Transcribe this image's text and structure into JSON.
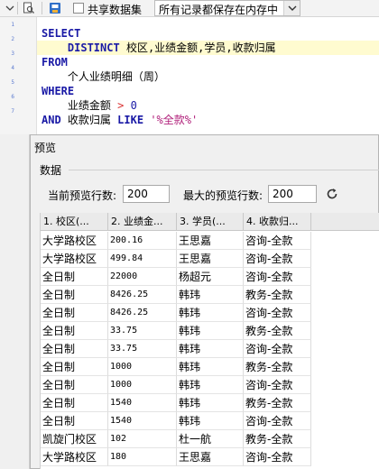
{
  "toolbar": {
    "share_label": "共享数据集",
    "storage_select": "所有记录都保存在内存中"
  },
  "editor": {
    "lines": [
      {
        "n": "1"
      },
      {
        "n": "2"
      },
      {
        "n": "3"
      },
      {
        "n": "4"
      },
      {
        "n": "5"
      },
      {
        "n": "6"
      },
      {
        "n": "7"
      }
    ],
    "select_kw": "SELECT",
    "distinct_kw": "DISTINCT",
    "columns": "校区,业绩金额,学员,收款归属",
    "from_kw": "FROM",
    "table": "个人业绩明细（周）",
    "where_kw": "WHERE",
    "cond1_field": "业绩金额",
    "cond1_op": ">",
    "cond1_val": "0",
    "and_kw": "AND",
    "cond2_field": "收款归属",
    "like_kw": "LIKE",
    "cond2_val": "'%全款%'"
  },
  "dialog": {
    "title": "预览",
    "group": "数据",
    "current_rows_label": "当前预览行数:",
    "current_rows_value": "200",
    "max_rows_label": "最大的预览行数:",
    "max_rows_value": "200"
  },
  "grid": {
    "headers": [
      "1. 校区(...",
      "2. 业绩金...",
      "3. 学员(...",
      "4. 收款归..."
    ],
    "rows": [
      [
        "大学路校区",
        "200.16",
        "王思嘉",
        "咨询-全款"
      ],
      [
        "大学路校区",
        "499.84",
        "王思嘉",
        "咨询-全款"
      ],
      [
        "全日制",
        "22000",
        "杨超元",
        "咨询-全款"
      ],
      [
        "全日制",
        "8426.25",
        "韩玮",
        "教务-全款"
      ],
      [
        "全日制",
        "8426.25",
        "韩玮",
        "咨询-全款"
      ],
      [
        "全日制",
        "33.75",
        "韩玮",
        "教务-全款"
      ],
      [
        "全日制",
        "33.75",
        "韩玮",
        "咨询-全款"
      ],
      [
        "全日制",
        "1000",
        "韩玮",
        "教务-全款"
      ],
      [
        "全日制",
        "1000",
        "韩玮",
        "咨询-全款"
      ],
      [
        "全日制",
        "1540",
        "韩玮",
        "教务-全款"
      ],
      [
        "全日制",
        "1540",
        "韩玮",
        "咨询-全款"
      ],
      [
        "凯旋门校区",
        "102",
        "杜一航",
        "教务-全款"
      ],
      [
        "大学路校区",
        "180",
        "王思嘉",
        "咨询-全款"
      ]
    ]
  }
}
